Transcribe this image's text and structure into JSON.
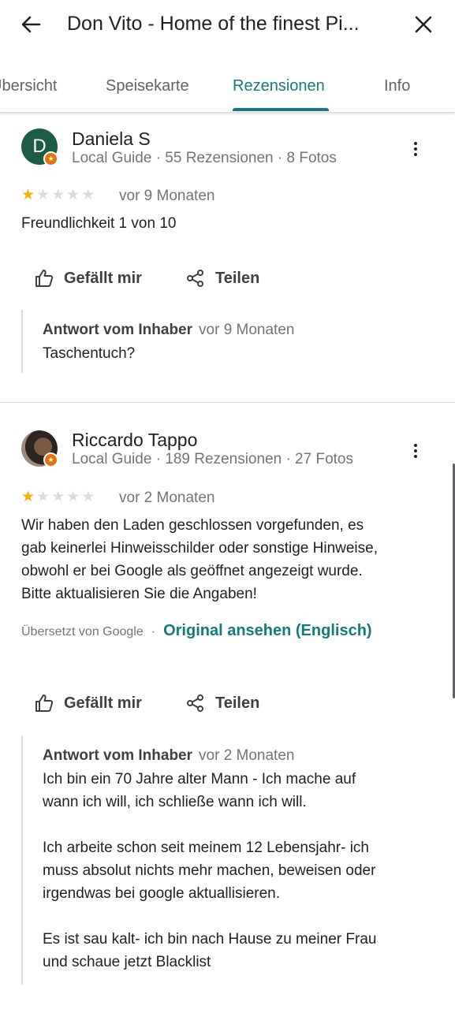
{
  "header": {
    "title": "Don Vito - Home of the finest Pi..."
  },
  "tabs": [
    {
      "label": "Übersicht",
      "active": false
    },
    {
      "label": "Speisekarte",
      "active": false
    },
    {
      "label": "Rezensionen",
      "active": true
    },
    {
      "label": "Info",
      "active": false
    }
  ],
  "reviews": [
    {
      "avatar_letter": "D",
      "author": "Daniela S",
      "meta": "Local Guide · 55 Rezensionen · 8 Fotos",
      "rating": 1,
      "rating_max": 5,
      "date": "vor 9 Monaten",
      "text": "Freundlichkeit 1 von 10",
      "like_label": "Gefällt mir",
      "share_label": "Teilen",
      "owner_reply": {
        "label": "Antwort vom Inhaber",
        "date": "vor 9 Monaten",
        "text": "Taschentuch?"
      }
    },
    {
      "author": "Riccardo Tappo",
      "meta": "Local Guide · 189 Rezensionen · 27 Fotos",
      "rating": 1,
      "rating_max": 5,
      "date": "vor 2 Monaten",
      "text_lines": [
        "Wir haben den Laden geschlossen vorgefunden, es",
        "gab keinerlei Hinweisschilder oder sonstige Hinweise,",
        "obwohl er bei Google als geöffnet angezeigt wurde.",
        "Bitte aktualisieren Sie die Angaben!"
      ],
      "translated_by": "Übersetzt von Google",
      "translated_separator": "·",
      "original_link": "Original ansehen (Englisch)",
      "like_label": "Gefällt mir",
      "share_label": "Teilen",
      "owner_reply": {
        "label": "Antwort vom Inhaber",
        "date": "vor 2 Monaten",
        "text": "Ich bin ein 70 Jahre alter Mann - Ich mache auf\nwann ich will, ich schließe wann ich will.\n\nIch arbeite schon seit meinem 12 Lebensjahr- ich\nmuss absolut nichts mehr machen, beweisen oder\nirgendwas bei google aktuallisieren.\n\nEs ist sau kalt- ich bin nach Hause zu meiner Frau\nund schaue jetzt Blacklist"
      }
    }
  ],
  "colors": {
    "accent": "#137a7f",
    "star": "#f5b400",
    "badge": "#e8710a",
    "avatar_bg": "#1e5b45"
  }
}
